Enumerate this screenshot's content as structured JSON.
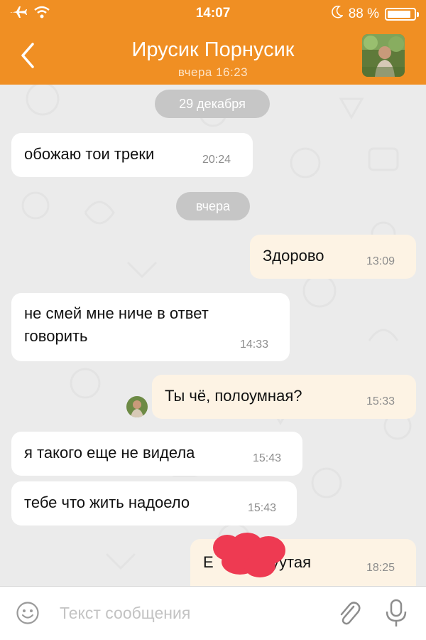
{
  "status_bar": {
    "time": "14:07",
    "battery_text": "88 %",
    "battery_level": 0.88,
    "icons": [
      "airplane-icon",
      "wifi-icon",
      "moon-icon",
      "battery-icon"
    ]
  },
  "header": {
    "back_icon": "chevron-left-icon",
    "title": "Ирусик Порнусик",
    "subtitle": "вчера 16:23",
    "colors": {
      "background": "#f08f23",
      "text": "#ffffff"
    }
  },
  "chat": {
    "date_separators": [
      "29 декабря",
      "вчера"
    ],
    "messages": [
      {
        "direction": "in",
        "text": "обожаю тои треки",
        "time": "20:24"
      },
      {
        "direction": "out",
        "text": "Здорово",
        "time": "13:09"
      },
      {
        "direction": "in",
        "text_line1": "не смей мне ниче в ответ",
        "text_line2": "говорить",
        "time": "14:33"
      },
      {
        "direction": "out",
        "text": "Ты чё, полоумная?",
        "time": "15:33"
      },
      {
        "direction": "in",
        "text": "я такого еще не видела",
        "time": "15:43"
      },
      {
        "direction": "in",
        "text": "тебе что жить надоело",
        "time": "15:43"
      },
      {
        "direction": "out",
        "text_start": "Е",
        "text_end": "уутая",
        "time": "18:25",
        "redacted": true
      }
    ],
    "colors": {
      "incoming": "#ffffff",
      "outgoing": "#fdf3e4",
      "timestamp": "#8d8d8d",
      "redaction": "#ee3a52"
    }
  },
  "input_bar": {
    "placeholder": "Текст сообщения",
    "value": "",
    "icons": [
      "emoji-icon",
      "paperclip-icon",
      "microphone-icon"
    ]
  }
}
